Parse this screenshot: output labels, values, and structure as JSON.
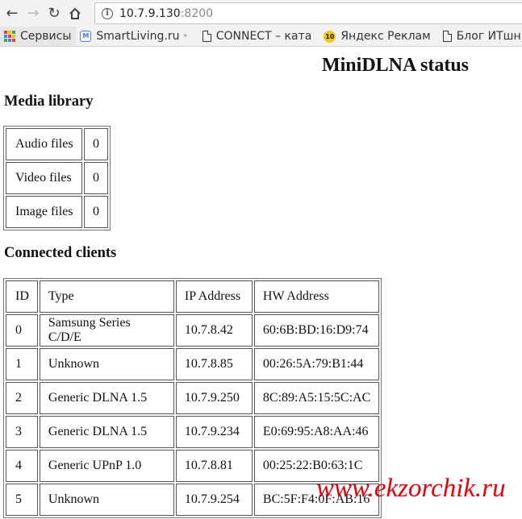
{
  "browser": {
    "url_host": "10.7.9.130",
    "url_port": ":8200",
    "bookmarks": [
      {
        "label": "Сервисы",
        "icon": "apps-grid-icon"
      },
      {
        "label": "SmartLiving.ru",
        "icon": "smartliving-favicon"
      },
      {
        "label": "CONNECT – ката",
        "icon": "page-icon"
      },
      {
        "label": "Яндекс Реклам",
        "icon": "yandex-favicon"
      },
      {
        "label": "Блог ИТшн",
        "icon": "page-icon"
      }
    ]
  },
  "page": {
    "title": "MiniDLNA status",
    "media_heading": "Media library",
    "media": [
      {
        "label": "Audio files",
        "value": "0"
      },
      {
        "label": "Video files",
        "value": "0"
      },
      {
        "label": "Image files",
        "value": "0"
      }
    ],
    "clients_heading": "Connected clients",
    "clients_headers": [
      "ID",
      "Type",
      "IP Address",
      "HW Address"
    ],
    "clients": [
      {
        "id": "0",
        "type": "Samsung Series C/D/E",
        "ip": "10.7.8.42",
        "hw": "60:6B:BD:16:D9:74"
      },
      {
        "id": "1",
        "type": "Unknown",
        "ip": "10.7.8.85",
        "hw": "00:26:5A:79:B1:44"
      },
      {
        "id": "2",
        "type": "Generic DLNA 1.5",
        "ip": "10.7.9.250",
        "hw": "8C:89:A5:15:5C:AC"
      },
      {
        "id": "3",
        "type": "Generic DLNA 1.5",
        "ip": "10.7.9.234",
        "hw": "E0:69:95:A8:AA:46"
      },
      {
        "id": "4",
        "type": "Generic UPnP 1.0",
        "ip": "10.7.8.81",
        "hw": "00:25:22:B0:63:1C"
      },
      {
        "id": "5",
        "type": "Unknown",
        "ip": "10.7.9.254",
        "hw": "BC:5F:F4:0F:AB:16"
      }
    ]
  },
  "watermark": "www.ekzorchik.ru"
}
